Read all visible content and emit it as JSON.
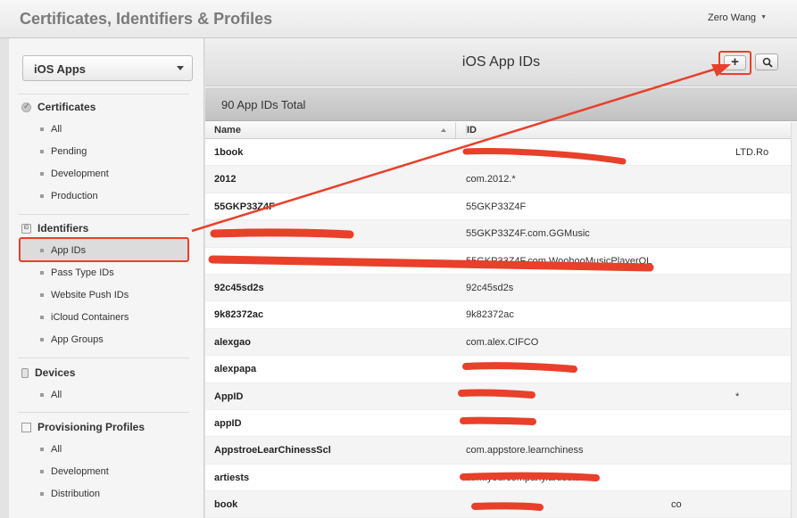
{
  "header": {
    "title": "Certificates, Identifiers & Profiles",
    "user": "Zero Wang"
  },
  "sidebar": {
    "platform": "iOS Apps",
    "sections": [
      {
        "title": "Certificates",
        "icon": "certificate-icon",
        "items": [
          "All",
          "Pending",
          "Development",
          "Production"
        ]
      },
      {
        "title": "Identifiers",
        "icon": "id-icon",
        "items": [
          "App IDs",
          "Pass Type IDs",
          "Website Push IDs",
          "iCloud Containers",
          "App Groups"
        ]
      },
      {
        "title": "Devices",
        "icon": "device-icon",
        "items": [
          "All"
        ]
      },
      {
        "title": "Provisioning Profiles",
        "icon": "profile-icon",
        "items": [
          "All",
          "Development",
          "Distribution"
        ]
      }
    ],
    "selected_item": "App IDs"
  },
  "main": {
    "title": "iOS App IDs",
    "add_label": "+",
    "total": "90 App IDs Total",
    "columns": {
      "name": "Name",
      "id": "ID"
    },
    "rows": [
      {
        "name": "1book",
        "id": "LTD.Ro"
      },
      {
        "name": "2012",
        "id": "com.2012.*"
      },
      {
        "name": "55GKP33Z4F",
        "id": "55GKP33Z4F"
      },
      {
        "name": "",
        "id": "55GKP33Z4F.com.GGMusic"
      },
      {
        "name": "",
        "id": "55GKP33Z4F.com.WoohooMusicPlayerQL"
      },
      {
        "name": "92c45sd2s",
        "id": "92c45sd2s"
      },
      {
        "name": "9k82372ac",
        "id": "9k82372ac"
      },
      {
        "name": "alexgao",
        "id": "com.alex.CIFCO"
      },
      {
        "name": "alexpapa",
        "id": ""
      },
      {
        "name": "AppID",
        "id": "*"
      },
      {
        "name": "appID",
        "id": ""
      },
      {
        "name": "AppstroeLearChinessScl",
        "id": "com.appstore.learnchiness"
      },
      {
        "name": "artiests",
        "id": "com.yourcompany.artiests"
      },
      {
        "name": "book",
        "id": "co"
      }
    ]
  },
  "colors": {
    "annotation": "#e8402a",
    "selected_bg": "#dcdcdc"
  }
}
